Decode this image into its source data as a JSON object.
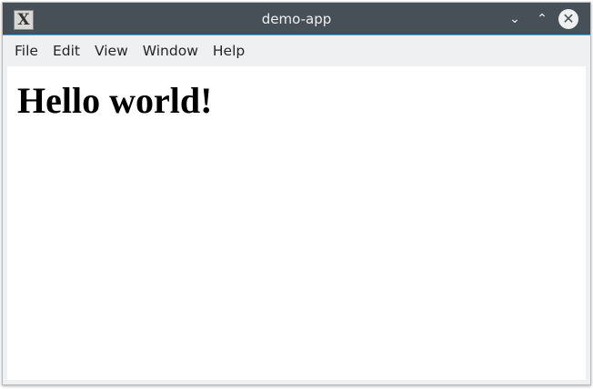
{
  "window": {
    "title": "demo-app",
    "icon": "x11-app-icon"
  },
  "controls": {
    "minimize": "⌄",
    "maximize": "⌃",
    "close": "✕"
  },
  "menu": [
    {
      "label": "File"
    },
    {
      "label": "Edit"
    },
    {
      "label": "View"
    },
    {
      "label": "Window"
    },
    {
      "label": "Help"
    }
  ],
  "content": {
    "heading": "Hello world!"
  }
}
